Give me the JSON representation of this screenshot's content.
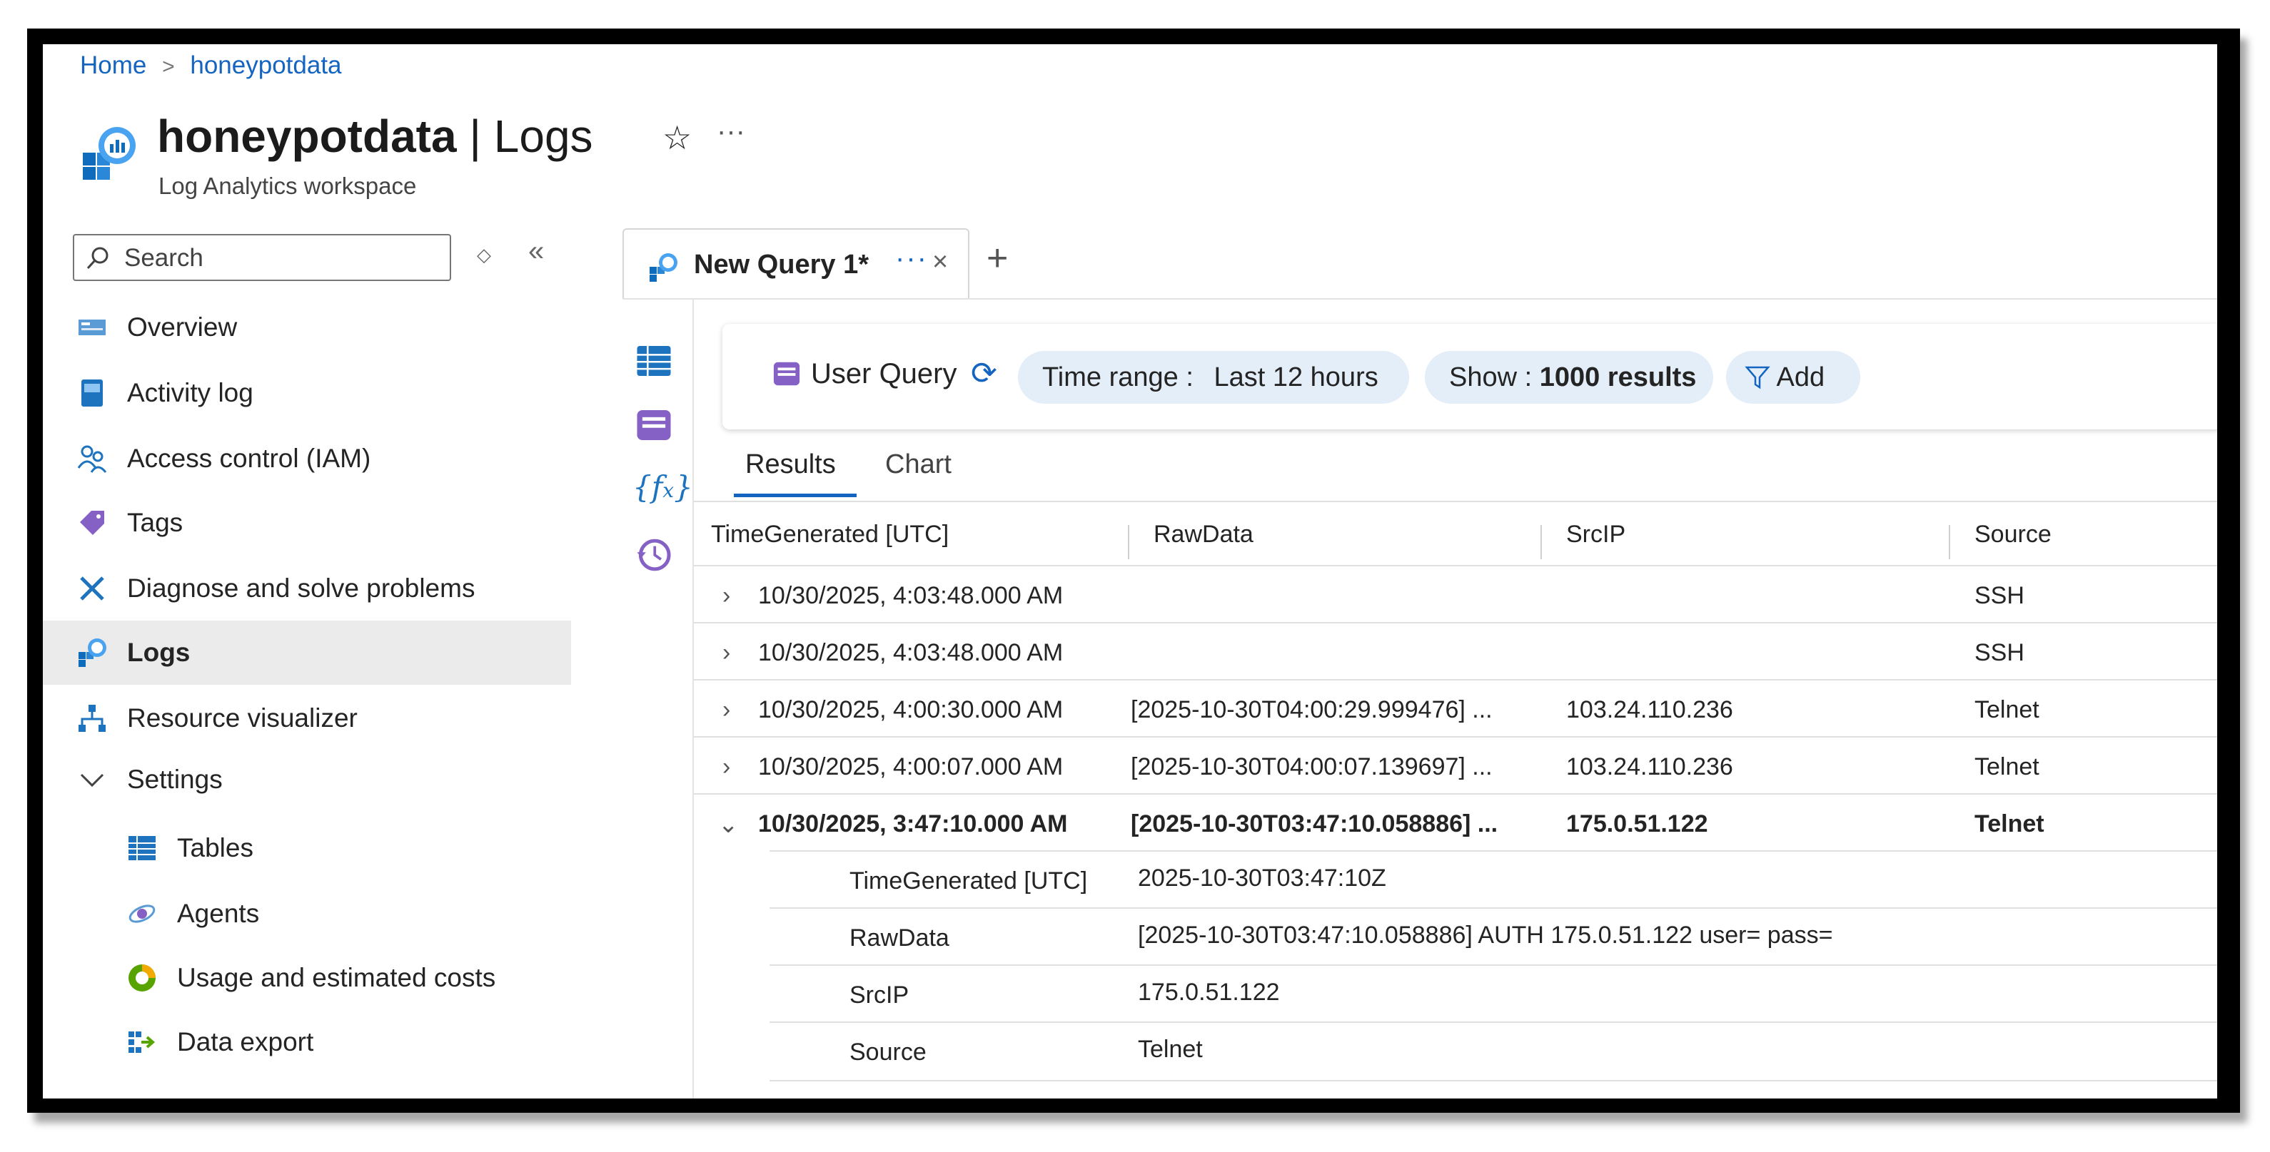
{
  "breadcrumb": {
    "home": "Home",
    "separator": ">",
    "current": "honeypotdata"
  },
  "header": {
    "title_main": "honeypotdata",
    "title_sep": " | ",
    "title_section": "Logs",
    "subtitle": "Log Analytics workspace",
    "star": "☆",
    "more": "···"
  },
  "sidebar": {
    "search_placeholder": "Search",
    "collapse": "«",
    "updown": "◇",
    "items": [
      {
        "label": "Overview"
      },
      {
        "label": "Activity log"
      },
      {
        "label": "Access control (IAM)"
      },
      {
        "label": "Tags"
      },
      {
        "label": "Diagnose and solve problems"
      },
      {
        "label": "Logs"
      },
      {
        "label": "Resource visualizer"
      },
      {
        "label": "Settings"
      },
      {
        "label": "Tables"
      },
      {
        "label": "Agents"
      },
      {
        "label": "Usage and estimated costs"
      },
      {
        "label": "Data export"
      }
    ]
  },
  "query_tab": {
    "label": "New Query 1*",
    "dots": "···",
    "close": "×",
    "add": "+"
  },
  "toolbar": {
    "user_query": "User Query",
    "time_prefix": "Time range : ",
    "time_value": "Last 12 hours",
    "show_prefix": "Show : ",
    "show_value": "1000 results",
    "add": "Add"
  },
  "result_tabs": {
    "results": "Results",
    "chart": "Chart"
  },
  "table": {
    "headers": [
      "TimeGenerated [UTC]",
      "RawData",
      "SrcIP",
      "Source"
    ],
    "rows": [
      {
        "time": "10/30/2025, 4:03:48.000 AM",
        "raw": "",
        "ip": "",
        "source": "SSH"
      },
      {
        "time": "10/30/2025, 4:03:48.000 AM",
        "raw": "",
        "ip": "",
        "source": "SSH"
      },
      {
        "time": "10/30/2025, 4:00:30.000 AM",
        "raw": "[2025-10-30T04:00:29.999476] ...",
        "ip": "103.24.110.236",
        "source": "Telnet"
      },
      {
        "time": "10/30/2025, 4:00:07.000 AM",
        "raw": "[2025-10-30T04:00:07.139697] ...",
        "ip": "103.24.110.236",
        "source": "Telnet"
      },
      {
        "time": "10/30/2025, 3:47:10.000 AM",
        "raw": "[2025-10-30T03:47:10.058886] ...",
        "ip": "175.0.51.122",
        "source": "Telnet"
      }
    ],
    "details": [
      {
        "key": "TimeGenerated [UTC]",
        "value": "2025-10-30T03:47:10Z"
      },
      {
        "key": "RawData",
        "value": "[2025-10-30T03:47:10.058886] AUTH 175.0.51.122 user= pass="
      },
      {
        "key": "SrcIP",
        "value": "175.0.51.122"
      },
      {
        "key": "Source",
        "value": "Telnet"
      }
    ]
  },
  "colors": {
    "accent": "#1565c0",
    "pill": "#e3eef9",
    "active_nav": "#ebebeb"
  }
}
